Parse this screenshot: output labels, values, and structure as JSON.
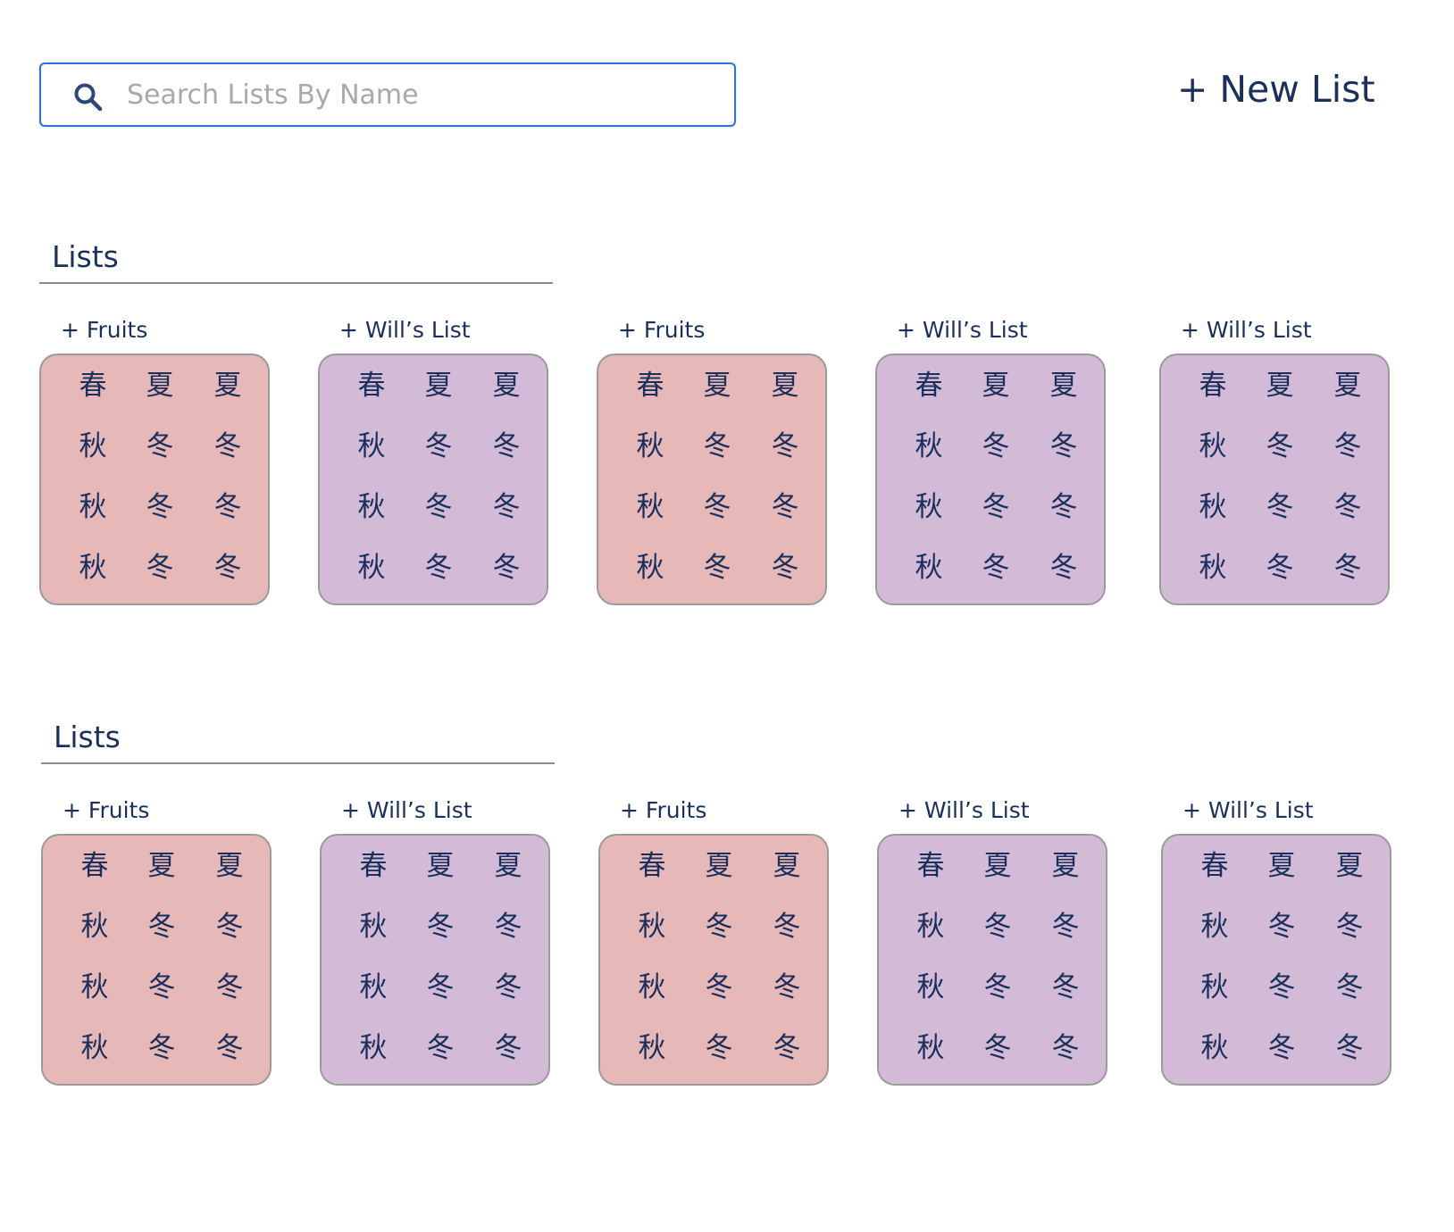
{
  "search": {
    "placeholder": "Search Lists By Name",
    "value": ""
  },
  "header": {
    "new_list_label": "+ New List"
  },
  "colors": {
    "pink_card": "#e7b8b8",
    "purple_card": "#d3bad7",
    "text": "#1b2f5c",
    "search_border": "#2f74d0"
  },
  "sections": [
    {
      "title": "Lists",
      "cards": [
        {
          "label": "+ Fruits",
          "color": "pink",
          "chars": [
            [
              "春",
              "夏",
              "夏"
            ],
            [
              "秋",
              "冬",
              "冬"
            ],
            [
              "秋",
              "冬",
              "冬"
            ],
            [
              "秋",
              "冬",
              "冬"
            ]
          ]
        },
        {
          "label": "+ Will’s List",
          "color": "purple",
          "chars": [
            [
              "春",
              "夏",
              "夏"
            ],
            [
              "秋",
              "冬",
              "冬"
            ],
            [
              "秋",
              "冬",
              "冬"
            ],
            [
              "秋",
              "冬",
              "冬"
            ]
          ]
        },
        {
          "label": "+ Fruits",
          "color": "pink",
          "chars": [
            [
              "春",
              "夏",
              "夏"
            ],
            [
              "秋",
              "冬",
              "冬"
            ],
            [
              "秋",
              "冬",
              "冬"
            ],
            [
              "秋",
              "冬",
              "冬"
            ]
          ]
        },
        {
          "label": "+ Will’s List",
          "color": "purple",
          "chars": [
            [
              "春",
              "夏",
              "夏"
            ],
            [
              "秋",
              "冬",
              "冬"
            ],
            [
              "秋",
              "冬",
              "冬"
            ],
            [
              "秋",
              "冬",
              "冬"
            ]
          ]
        },
        {
          "label": "+ Will’s List",
          "color": "purple",
          "chars": [
            [
              "春",
              "夏",
              "夏"
            ],
            [
              "秋",
              "冬",
              "冬"
            ],
            [
              "秋",
              "冬",
              "冬"
            ],
            [
              "秋",
              "冬",
              "冬"
            ]
          ]
        }
      ]
    },
    {
      "title": "Lists",
      "cards": [
        {
          "label": "+ Fruits",
          "color": "pink",
          "chars": [
            [
              "春",
              "夏",
              "夏"
            ],
            [
              "秋",
              "冬",
              "冬"
            ],
            [
              "秋",
              "冬",
              "冬"
            ],
            [
              "秋",
              "冬",
              "冬"
            ]
          ]
        },
        {
          "label": "+ Will’s List",
          "color": "purple",
          "chars": [
            [
              "春",
              "夏",
              "夏"
            ],
            [
              "秋",
              "冬",
              "冬"
            ],
            [
              "秋",
              "冬",
              "冬"
            ],
            [
              "秋",
              "冬",
              "冬"
            ]
          ]
        },
        {
          "label": "+ Fruits",
          "color": "pink",
          "chars": [
            [
              "春",
              "夏",
              "夏"
            ],
            [
              "秋",
              "冬",
              "冬"
            ],
            [
              "秋",
              "冬",
              "冬"
            ],
            [
              "秋",
              "冬",
              "冬"
            ]
          ]
        },
        {
          "label": "+ Will’s List",
          "color": "purple",
          "chars": [
            [
              "春",
              "夏",
              "夏"
            ],
            [
              "秋",
              "冬",
              "冬"
            ],
            [
              "秋",
              "冬",
              "冬"
            ],
            [
              "秋",
              "冬",
              "冬"
            ]
          ]
        },
        {
          "label": "+ Will’s List",
          "color": "purple",
          "chars": [
            [
              "春",
              "夏",
              "夏"
            ],
            [
              "秋",
              "冬",
              "冬"
            ],
            [
              "秋",
              "冬",
              "冬"
            ],
            [
              "秋",
              "冬",
              "冬"
            ]
          ]
        }
      ]
    }
  ]
}
